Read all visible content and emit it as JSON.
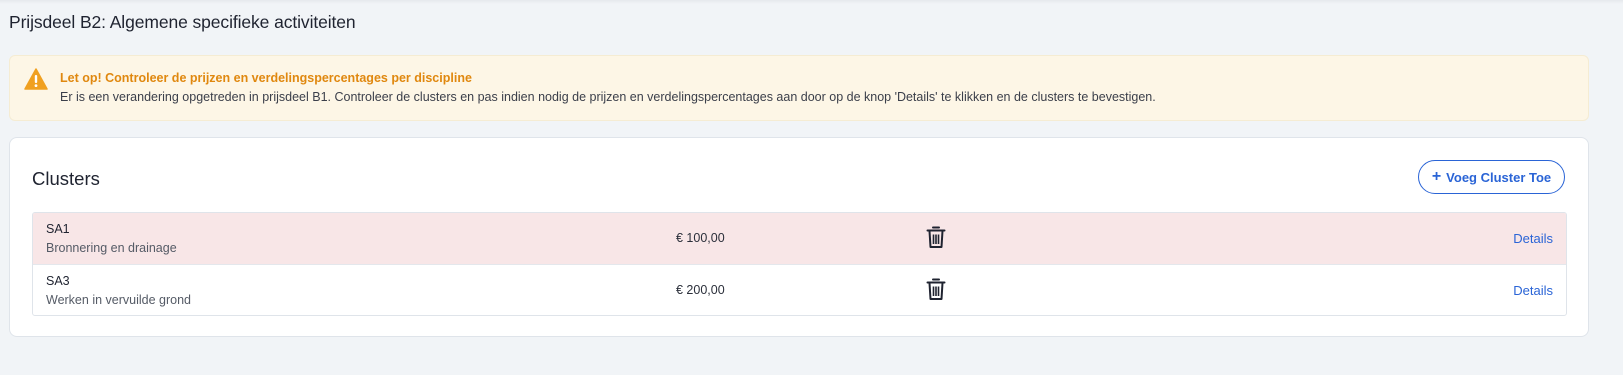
{
  "page": {
    "title": "Prijsdeel B2: Algemene specifieke activiteiten"
  },
  "alert": {
    "icon": "warning-triangle-icon",
    "title": "Let op! Controleer de prijzen en verdelingspercentages per discipline",
    "text": "Er is een verandering opgetreden in prijsdeel B1. Controleer de clusters en pas indien nodig de prijzen en verdelingspercentages aan door op de knop 'Details' te klikken en de clusters te bevestigen.",
    "color": "#e0880f",
    "background": "#fdf6e6"
  },
  "clusters": {
    "title": "Clusters",
    "add_button": {
      "icon": "plus-icon",
      "label": "Voeg Cluster Toe"
    },
    "rows": [
      {
        "code": "SA1",
        "description": "Bronnering en drainage",
        "price": "€ 100,00",
        "delete_icon": "trash-icon",
        "details_label": "Details",
        "highlighted": true
      },
      {
        "code": "SA3",
        "description": "Werken in vervuilde grond",
        "price": "€ 200,00",
        "delete_icon": "trash-icon",
        "details_label": "Details",
        "highlighted": false
      }
    ]
  },
  "colors": {
    "accent": "#2a64d6",
    "highlight_row": "#f8e6e7",
    "page_background": "#f1f4f7"
  }
}
